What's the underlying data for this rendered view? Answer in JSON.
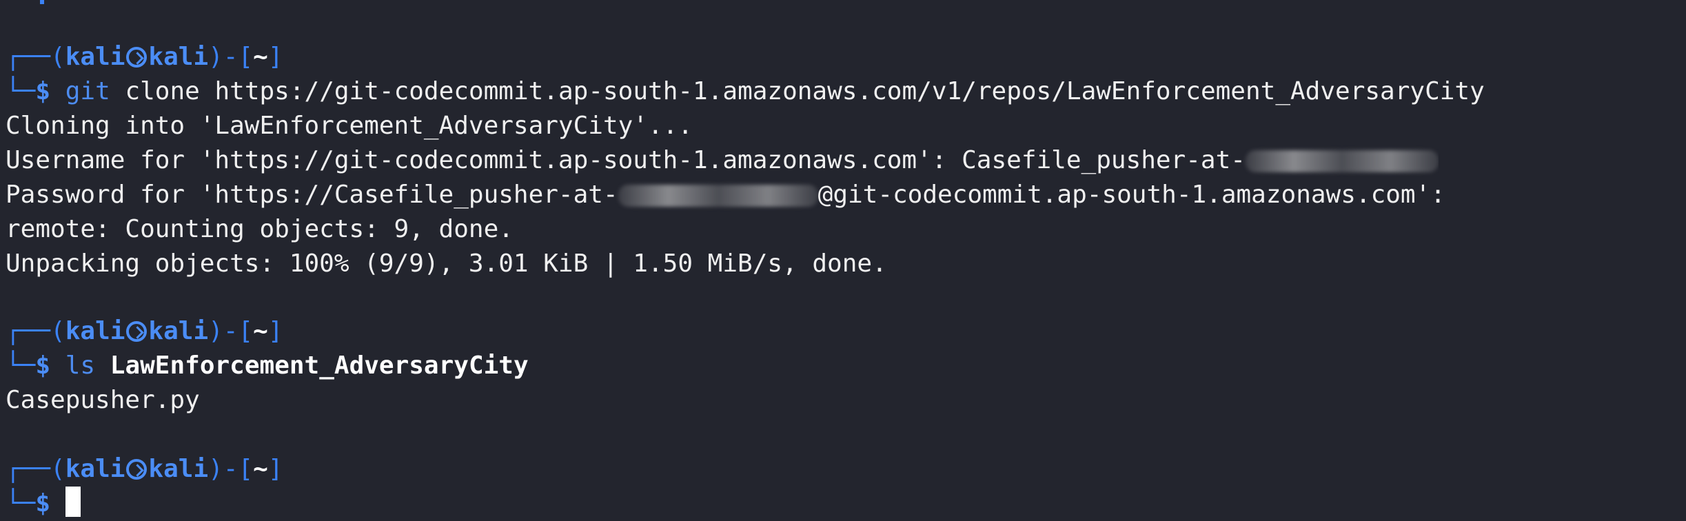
{
  "terminal": {
    "prompt": {
      "corner_top": "┌──",
      "paren_open": "(",
      "user": "kali",
      "host": "kali",
      "paren_close": ")",
      "dash_bracket": "-[",
      "dir": "~",
      "bracket_close": "]",
      "corner_bottom": "└─",
      "dollar": "$"
    },
    "blocks": [
      {
        "command_name": "git",
        "command_args": " clone https://git-codecommit.ap-south-1.amazonaws.com/v1/repos/LawEnforcement_AdversaryCity",
        "output": [
          "Cloning into 'LawEnforcement_AdversaryCity'...",
          "Username for 'https://git-codecommit.ap-south-1.amazonaws.com': Casefile_pusher-at-",
          "Password for 'https://Casefile_pusher-at-",
          "remote: Counting objects: 9, done.",
          "Unpacking objects: 100% (9/9), 3.01 KiB | 1.50 MiB/s, done."
        ],
        "password_suffix": "@git-codecommit.ap-south-1.amazonaws.com':"
      },
      {
        "command_name": "ls",
        "command_args": "LawEnforcement_AdversaryCity",
        "output": [
          "Casepusher.py"
        ]
      }
    ]
  },
  "icons": {
    "kali_separator": "kali-dragon-icon",
    "cursor": "block-cursor"
  },
  "colors": {
    "background": "#23252e",
    "prompt_blue": "#4b8df6",
    "text": "#f0f0f0"
  }
}
